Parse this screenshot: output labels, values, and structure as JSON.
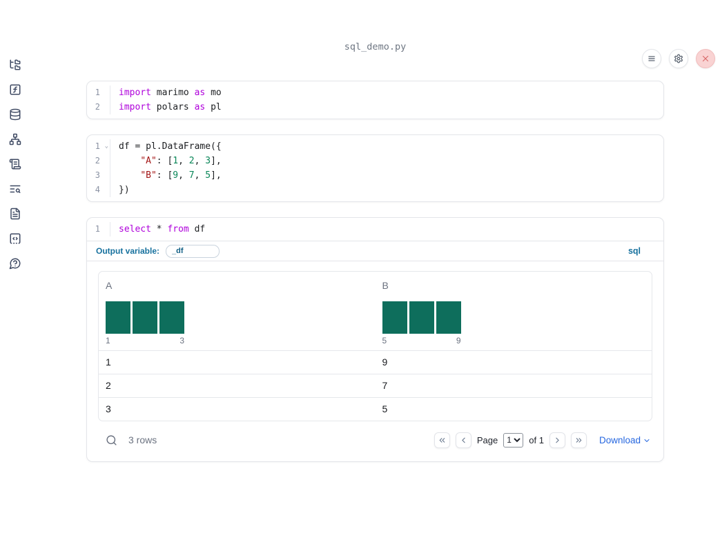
{
  "window": {
    "title": "sql_demo.py"
  },
  "topbar": {
    "buttons": [
      {
        "name": "menu",
        "icon": "hamburger-icon"
      },
      {
        "name": "settings",
        "icon": "gear-icon"
      },
      {
        "name": "close",
        "icon": "close-icon"
      }
    ]
  },
  "sidebar": {
    "items": [
      {
        "name": "file-explorer",
        "icon": "folder-tree-icon"
      },
      {
        "name": "variables",
        "icon": "function-square-icon"
      },
      {
        "name": "datasources",
        "icon": "database-icon"
      },
      {
        "name": "dependencies",
        "icon": "network-icon"
      },
      {
        "name": "scratchpad",
        "icon": "scroll-text-icon"
      },
      {
        "name": "logs",
        "icon": "text-search-icon"
      },
      {
        "name": "documentation",
        "icon": "file-text-icon"
      },
      {
        "name": "snippets",
        "icon": "square-code-icon"
      },
      {
        "name": "help-chat",
        "icon": "message-question-icon"
      }
    ]
  },
  "cells": [
    {
      "id": "imports",
      "lines": [
        {
          "n": "1",
          "tokens": [
            [
              "kw",
              "import"
            ],
            [
              "pl",
              " marimo "
            ],
            [
              "kw",
              "as"
            ],
            [
              "pl",
              " mo"
            ]
          ]
        },
        {
          "n": "2",
          "tokens": [
            [
              "kw",
              "import"
            ],
            [
              "pl",
              " polars "
            ],
            [
              "kw",
              "as"
            ],
            [
              "pl",
              " pl"
            ]
          ]
        }
      ]
    },
    {
      "id": "dataframe",
      "lines": [
        {
          "n": "1",
          "fold": true,
          "tokens": [
            [
              "pl",
              "df = pl.DataFrame({"
            ]
          ]
        },
        {
          "n": "2",
          "tokens": [
            [
              "pl",
              "    "
            ],
            [
              "str",
              "\"A\""
            ],
            [
              "pl",
              ": ["
            ],
            [
              "num",
              "1"
            ],
            [
              "pl",
              ", "
            ],
            [
              "num",
              "2"
            ],
            [
              "pl",
              ", "
            ],
            [
              "num",
              "3"
            ],
            [
              "pl",
              "],"
            ]
          ]
        },
        {
          "n": "3",
          "tokens": [
            [
              "pl",
              "    "
            ],
            [
              "str",
              "\"B\""
            ],
            [
              "pl",
              ": ["
            ],
            [
              "num",
              "9"
            ],
            [
              "pl",
              ", "
            ],
            [
              "num",
              "7"
            ],
            [
              "pl",
              ", "
            ],
            [
              "num",
              "5"
            ],
            [
              "pl",
              "],"
            ]
          ]
        },
        {
          "n": "4",
          "tokens": [
            [
              "pl",
              "})"
            ]
          ]
        }
      ]
    },
    {
      "id": "sql",
      "lines": [
        {
          "n": "1",
          "tokens": [
            [
              "kw",
              "select"
            ],
            [
              "pl",
              " * "
            ],
            [
              "kw",
              "from"
            ],
            [
              "pl",
              " df"
            ]
          ]
        }
      ],
      "footer": {
        "label": "Output variable:",
        "value": "_df",
        "language": "sql"
      }
    }
  ],
  "output": {
    "table": {
      "columns": [
        {
          "name": "A",
          "histogram": {
            "bars": [
              1,
              1,
              1
            ],
            "min_label": "1",
            "max_label": "3"
          }
        },
        {
          "name": "B",
          "histogram": {
            "bars": [
              1,
              1,
              1
            ],
            "min_label": "5",
            "max_label": "9"
          }
        }
      ],
      "rows": [
        [
          "1",
          "9"
        ],
        [
          "2",
          "7"
        ],
        [
          "3",
          "5"
        ]
      ]
    },
    "footer": {
      "row_count": "3 rows",
      "search_icon": "search-icon",
      "pagination": {
        "first_icon": "chevrons-left-icon",
        "prev_icon": "chevron-left-icon",
        "page_label": "Page",
        "page_value": "1",
        "of_label": "of 1",
        "next_icon": "chevron-right-icon",
        "last_icon": "chevrons-right-icon"
      },
      "download_label": "Download",
      "download_icon": "chevron-down-icon"
    }
  },
  "colors": {
    "keyword": "#af00db",
    "string": "#a31515",
    "number": "#098658",
    "histogram_bar": "#0e6e5c",
    "teal_label": "#17719e",
    "link_blue": "#2667e0",
    "close_button_bg": "#f9d3d3",
    "close_button_x": "#d96868",
    "sidebar_icon": "#3f4a63",
    "muted_text": "#6b7280"
  }
}
